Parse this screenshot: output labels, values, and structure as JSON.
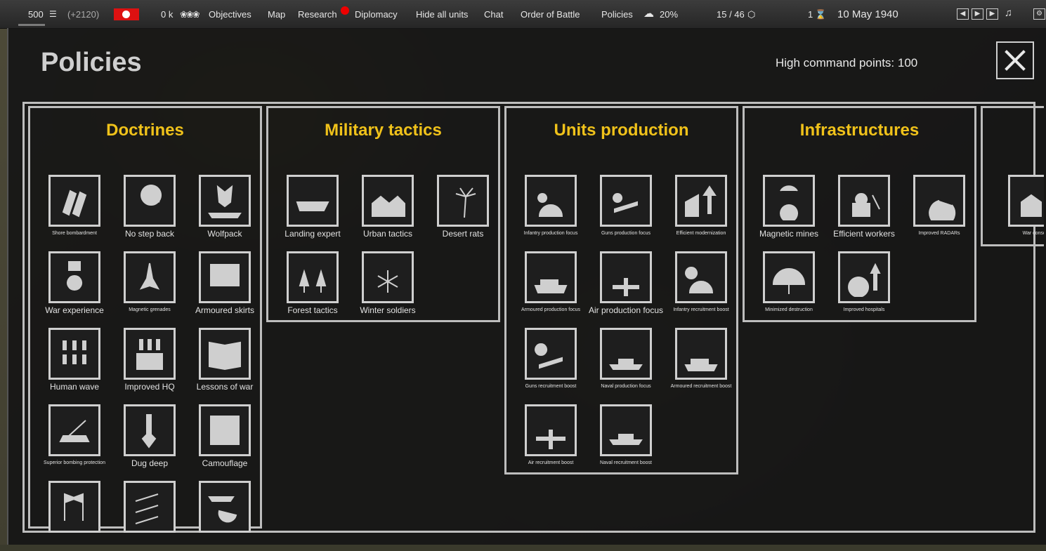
{
  "topbar": {
    "money": "500",
    "money_delta": "(+2120)",
    "manpower": "0 k",
    "menu": [
      "Objectives",
      "Map",
      "Research",
      "Diplomacy",
      "Hide all units",
      "Chat",
      "Order of Battle",
      "Policies"
    ],
    "weather": "20%",
    "supply": "15 / 46",
    "turn": "1",
    "date": "10 May 1940",
    "media_icons": [
      "skip-back-icon",
      "play-pause-icon",
      "skip-forward-icon",
      "music-icon",
      "settings-icon"
    ]
  },
  "panel": {
    "title": "Policies",
    "command_points": "High command points: 100"
  },
  "columns": [
    {
      "title": "Doctrines",
      "policies": [
        {
          "label": "Shore bombardment",
          "icon": "shells-icon",
          "small": true
        },
        {
          "label": "No step back",
          "icon": "no-retreat-icon",
          "small": false
        },
        {
          "label": "Wolfpack",
          "icon": "wolf-submarine-icon",
          "small": false
        },
        {
          "label": "War experience",
          "icon": "medal-icon",
          "small": false
        },
        {
          "label": "Magnetic grenades",
          "icon": "grenade-icon",
          "small": true
        },
        {
          "label": "Armoured skirts",
          "icon": "armor-plate-icon",
          "small": false
        },
        {
          "label": "Human wave",
          "icon": "soldiers-icon",
          "small": false
        },
        {
          "label": "Improved HQ",
          "icon": "hq-icon",
          "small": false
        },
        {
          "label": "Lessons of war",
          "icon": "book-icon",
          "small": false
        },
        {
          "label": "Superior bombing protection",
          "icon": "aa-gun-icon",
          "small": true
        },
        {
          "label": "Dug deep",
          "icon": "shovel-icon",
          "small": false
        },
        {
          "label": "Camouflage",
          "icon": "camo-icon",
          "small": false
        },
        {
          "label": "",
          "icon": "flags-icon",
          "small": false
        },
        {
          "label": "",
          "icon": "artillery-icon",
          "small": false
        },
        {
          "label": "",
          "icon": "air-support-icon",
          "small": false
        }
      ]
    },
    {
      "title": "Military tactics",
      "policies": [
        {
          "label": "Landing expert",
          "icon": "landing-craft-icon",
          "small": false
        },
        {
          "label": "Urban tactics",
          "icon": "houses-icon",
          "small": false
        },
        {
          "label": "Desert rats",
          "icon": "palm-icon",
          "small": false
        },
        {
          "label": "Forest tactics",
          "icon": "trees-icon",
          "small": false
        },
        {
          "label": "Winter soldiers",
          "icon": "snowflake-icon",
          "small": false
        }
      ]
    },
    {
      "title": "Units production",
      "policies": [
        {
          "label": "Infantry production focus",
          "icon": "gear-helmet-icon",
          "small": true
        },
        {
          "label": "Guns production focus",
          "icon": "gear-gun-icon",
          "small": true
        },
        {
          "label": "Efficient modernization",
          "icon": "factory-up-icon",
          "small": true
        },
        {
          "label": "Armoured production focus",
          "icon": "gear-tank-icon",
          "small": true
        },
        {
          "label": "Air production focus",
          "icon": "gear-plane-icon",
          "small": false
        },
        {
          "label": "Infantry recruitment boost",
          "icon": "clock-helmet-icon",
          "small": true
        },
        {
          "label": "Guns recruitment boost",
          "icon": "clock-gun-icon",
          "small": true
        },
        {
          "label": "Naval production focus",
          "icon": "gear-ship-icon",
          "small": true
        },
        {
          "label": "Armoured recruitment boost",
          "icon": "clock-tank-icon",
          "small": true
        },
        {
          "label": "Air recruitment boost",
          "icon": "clock-plane-icon",
          "small": true
        },
        {
          "label": "Naval recruitment boost",
          "icon": "clock-ship-icon",
          "small": true
        }
      ]
    },
    {
      "title": "Infrastructures",
      "policies": [
        {
          "label": "Magnetic mines",
          "icon": "mine-icon",
          "small": false
        },
        {
          "label": "Efficient workers",
          "icon": "worker-icon",
          "small": false
        },
        {
          "label": "Improved RADARs",
          "icon": "radar-icon",
          "small": true
        },
        {
          "label": "Minimized destruction",
          "icon": "umbrella-icon",
          "small": true
        },
        {
          "label": "Improved hospitals",
          "icon": "hospital-icon",
          "small": true
        }
      ]
    },
    {
      "title": "",
      "policies": [
        {
          "label": "War consc",
          "icon": "conscription-icon",
          "small": true
        }
      ]
    }
  ],
  "colors": {
    "accent": "#f0c21a",
    "frame": "#bdbdbd",
    "panel": "#161616"
  }
}
